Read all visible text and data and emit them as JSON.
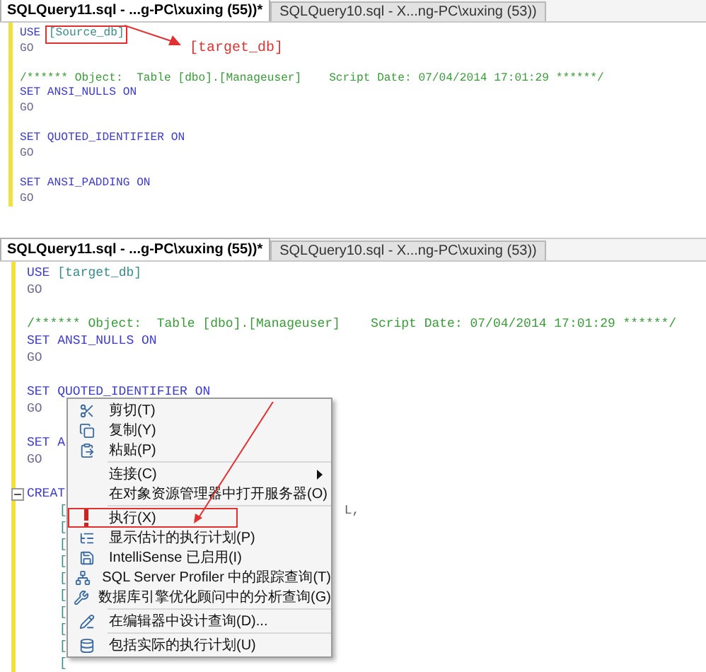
{
  "panels": [
    {
      "tabs": [
        {
          "label": "SQLQuery11.sql - ...g-PC\\xuxing (55))*",
          "selected": true
        },
        {
          "label": "SQLQuery10.sql - X...ng-PC\\xuxing (53))",
          "selected": false
        }
      ],
      "blocks": [
        [
          {
            "segments": [
              {
                "kind": "keyword",
                "text": "USE"
              },
              {
                "kind": "identifier",
                "text": "[Source_db]",
                "boxed": true
              }
            ]
          },
          {
            "segments": [
              {
                "kind": "batch",
                "text": "GO"
              }
            ]
          }
        ],
        [
          {
            "segments": [
              {
                "kind": "comment",
                "text": "/****** Object:  Table [dbo].[Manageuser]    Script Date: 07/04/2014 17:01:29 ******/"
              }
            ]
          },
          {
            "segments": [
              {
                "kind": "keyword",
                "text": "SET ANSI_NULLS ON"
              }
            ]
          },
          {
            "segments": [
              {
                "kind": "batch",
                "text": "GO"
              }
            ]
          }
        ],
        [
          {
            "segments": [
              {
                "kind": "keyword",
                "text": "SET QUOTED_IDENTIFIER ON"
              }
            ]
          },
          {
            "segments": [
              {
                "kind": "batch",
                "text": "GO"
              }
            ]
          }
        ],
        [
          {
            "segments": [
              {
                "kind": "keyword",
                "text": "SET ANSI_PADDING ON"
              }
            ]
          },
          {
            "segments": [
              {
                "kind": "batch",
                "text": "GO"
              }
            ]
          }
        ]
      ],
      "annotation": "[target_db]"
    },
    {
      "tabs": [
        {
          "label": "SQLQuery11.sql - ...g-PC\\xuxing (55))*",
          "selected": true
        },
        {
          "label": "SQLQuery10.sql - X...ng-PC\\xuxing (53))",
          "selected": false
        }
      ],
      "blocks": [
        [
          {
            "segments": [
              {
                "kind": "keyword",
                "text": "USE"
              },
              {
                "kind": "identifier",
                "text": "[target_db]",
                "boxed": false
              }
            ]
          },
          {
            "segments": [
              {
                "kind": "batch",
                "text": "GO"
              }
            ]
          }
        ],
        [
          {
            "segments": [
              {
                "kind": "comment",
                "text": "/****** Object:  Table [dbo].[Manageuser]    Script Date: 07/04/2014 17:01:29 ******/"
              }
            ]
          },
          {
            "segments": [
              {
                "kind": "keyword",
                "text": "SET ANSI_NULLS ON"
              }
            ]
          },
          {
            "segments": [
              {
                "kind": "batch",
                "text": "GO"
              }
            ]
          }
        ],
        [
          {
            "segments": [
              {
                "kind": "keyword",
                "text": "SET QUOTED_IDENTIFIER ON"
              }
            ]
          },
          {
            "segments": [
              {
                "kind": "batch",
                "text": "GO"
              }
            ]
          }
        ],
        [
          {
            "segments": [
              {
                "kind": "keyword",
                "text": "SET A"
              }
            ]
          },
          {
            "segments": [
              {
                "kind": "batch",
                "text": "GO"
              }
            ]
          }
        ],
        [
          {
            "collapsible": true,
            "segments": [
              {
                "kind": "keyword",
                "text": "CREAT"
              }
            ]
          },
          {
            "indented": true,
            "segments": [
              {
                "kind": "identifier",
                "text": "["
              },
              {
                "kind": "clipped",
                "text": "L,"
              }
            ]
          },
          {
            "indented": true,
            "segments": [
              {
                "kind": "identifier",
                "text": "["
              }
            ]
          },
          {
            "indented": true,
            "segments": [
              {
                "kind": "identifier",
                "text": "["
              }
            ]
          },
          {
            "indented": true,
            "segments": [
              {
                "kind": "identifier",
                "text": "["
              }
            ]
          },
          {
            "indented": true,
            "segments": [
              {
                "kind": "identifier",
                "text": "["
              }
            ]
          },
          {
            "indented": true,
            "segments": [
              {
                "kind": "identifier",
                "text": "["
              }
            ]
          },
          {
            "indented": true,
            "segments": [
              {
                "kind": "identifier",
                "text": "["
              }
            ]
          },
          {
            "indented": true,
            "segments": [
              {
                "kind": "identifier",
                "text": "["
              }
            ]
          },
          {
            "indented": true,
            "segments": [
              {
                "kind": "identifier",
                "text": "["
              }
            ]
          },
          {
            "indented": true,
            "segments": [
              {
                "kind": "identifier",
                "text": "["
              }
            ]
          }
        ]
      ],
      "context_menu": {
        "groups": [
          [
            {
              "label": "剪切(T)",
              "submenu": false,
              "highlighted": false
            },
            {
              "label": "复制(Y)",
              "submenu": false,
              "highlighted": false
            },
            {
              "label": "粘贴(P)",
              "submenu": false,
              "highlighted": false
            }
          ],
          [
            {
              "label": "连接(C)",
              "submenu": true,
              "highlighted": false
            },
            {
              "label": "在对象资源管理器中打开服务器(O)",
              "submenu": false,
              "highlighted": false
            }
          ],
          [
            {
              "label": "执行(X)",
              "submenu": false,
              "highlighted": true
            },
            {
              "label": "显示估计的执行计划(P)",
              "submenu": false,
              "highlighted": false
            },
            {
              "label": "IntelliSense 已启用(I)",
              "submenu": false,
              "highlighted": false
            },
            {
              "label": "SQL Server Profiler 中的跟踪查询(T)",
              "submenu": false,
              "highlighted": false
            },
            {
              "label": "数据库引擎优化顾问中的分析查询(G)",
              "submenu": false,
              "highlighted": false
            }
          ],
          [
            {
              "label": "在编辑器中设计查询(D)...",
              "submenu": false,
              "highlighted": false
            }
          ],
          [
            {
              "label": "包括实际的执行计划(U)",
              "submenu": false,
              "highlighted": false
            }
          ]
        ]
      }
    }
  ]
}
